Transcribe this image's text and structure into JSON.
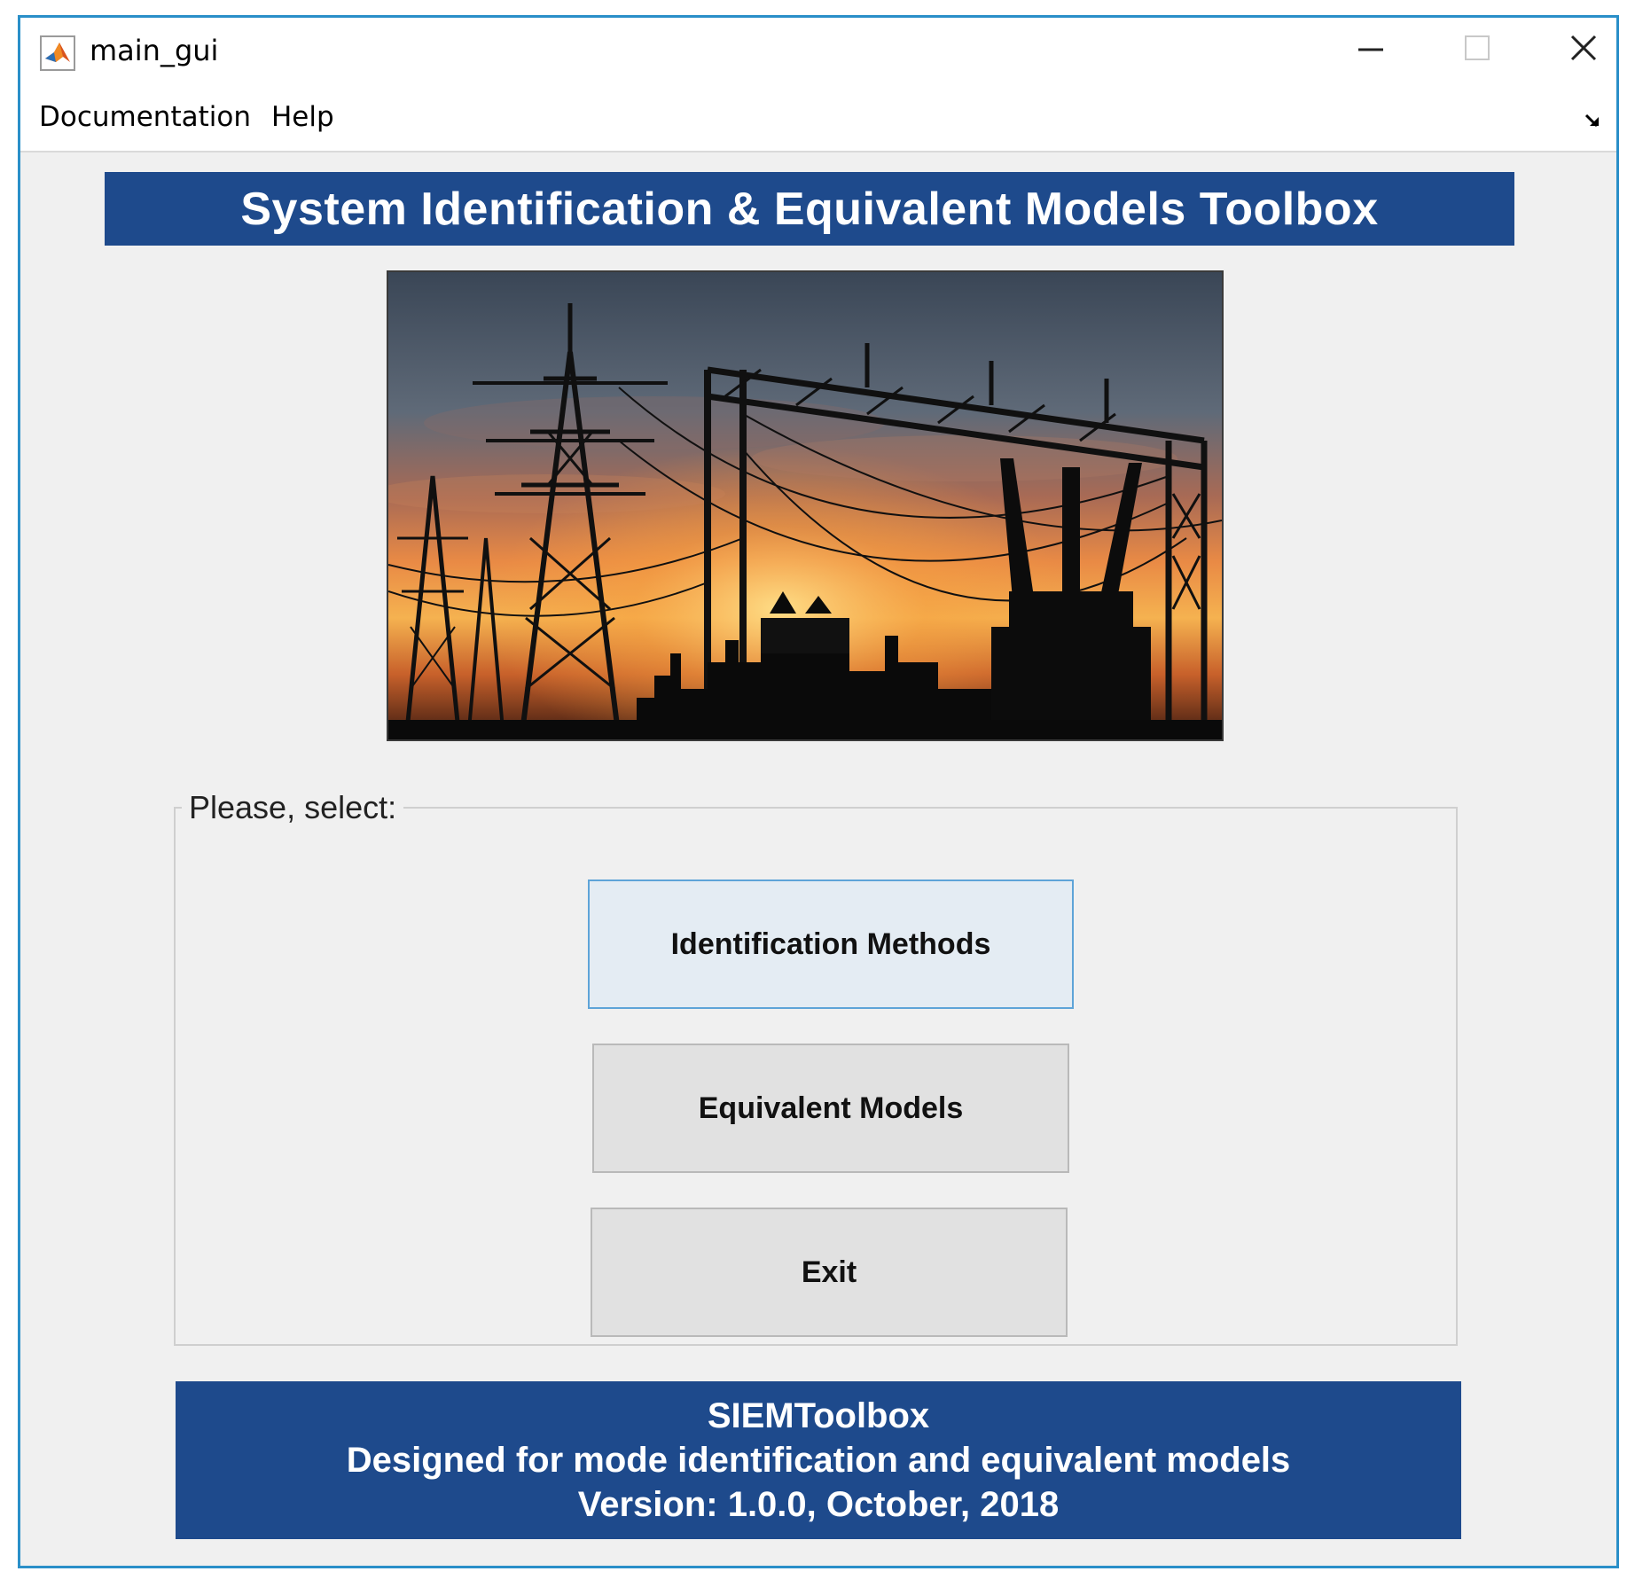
{
  "window": {
    "title": "main_gui",
    "controls": {
      "minimize": "minimize-icon",
      "maximize": "maximize-icon",
      "close": "close-icon"
    }
  },
  "menu": {
    "items": [
      {
        "label": "Documentation"
      },
      {
        "label": "Help"
      }
    ]
  },
  "header": {
    "title": "System Identification & Equivalent Models Toolbox"
  },
  "panel": {
    "legend": "Please, select:",
    "buttons": {
      "identification": "Identification Methods",
      "equivalent": "Equivalent Models",
      "exit": "Exit"
    }
  },
  "footer": {
    "line1": "SIEMToolbox",
    "line2": "Designed for mode identification and equivalent models",
    "line3": "Version: 1.0.0, October, 2018"
  },
  "colors": {
    "banner": "#1e4a8c",
    "window_border": "#2a8fc8",
    "primary_button_border": "#5ea4d8",
    "background": "#f0f0f0"
  }
}
